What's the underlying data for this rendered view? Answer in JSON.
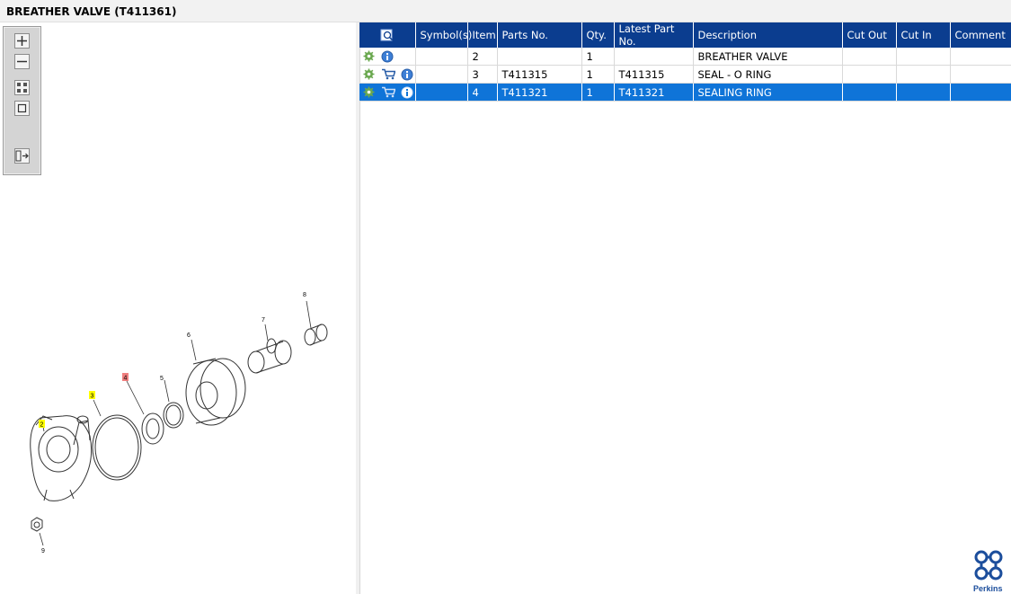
{
  "window": {
    "title": "BREATHER VALVE (T411361)"
  },
  "toolbar": {
    "buttons": [
      {
        "icon": "zoom-in-icon"
      },
      {
        "icon": "zoom-out-icon"
      },
      {
        "icon": "fit-page-icon"
      },
      {
        "icon": "actual-size-icon"
      },
      {
        "icon": "toggle-panel-icon"
      }
    ]
  },
  "diagram": {
    "callouts": [
      {
        "label": "2",
        "highlight": "#ffff00"
      },
      {
        "label": "3",
        "highlight": "#ffff00"
      },
      {
        "label": "4",
        "highlight": "#f08080"
      },
      {
        "label": "5",
        "highlight": "none"
      },
      {
        "label": "6",
        "highlight": "none"
      },
      {
        "label": "7",
        "highlight": "none"
      },
      {
        "label": "8",
        "highlight": "none"
      },
      {
        "label": "9",
        "highlight": "none"
      }
    ]
  },
  "parts_table": {
    "header_icon": "search-list-icon",
    "columns": [
      "Symbol(s)",
      "Item",
      "Parts No.",
      "Qty.",
      "Latest Part No.",
      "Description",
      "Cut Out",
      "Cut In",
      "Comment"
    ],
    "rows": [
      {
        "icons": [
          "gear-icon",
          "info-icon"
        ],
        "symbols": "",
        "item": "2",
        "part_no": "",
        "qty": "1",
        "latest_part_no": "",
        "description": "BREATHER VALVE",
        "cut_out": "",
        "cut_in": "",
        "comment": "",
        "selected": false
      },
      {
        "icons": [
          "gear-icon",
          "cart-icon",
          "info-icon"
        ],
        "symbols": "",
        "item": "3",
        "part_no": "T411315",
        "qty": "1",
        "latest_part_no": "T411315",
        "description": "SEAL - O RING",
        "cut_out": "",
        "cut_in": "",
        "comment": "",
        "selected": false
      },
      {
        "icons": [
          "gear-icon",
          "cart-icon",
          "info-icon"
        ],
        "symbols": "",
        "item": "4",
        "part_no": "T411321",
        "qty": "1",
        "latest_part_no": "T411321",
        "description": "SEALING RING",
        "cut_out": "",
        "cut_in": "",
        "comment": "",
        "selected": true
      }
    ]
  },
  "brand": {
    "name": "Perkins",
    "color": "#1c4e9c"
  },
  "colors": {
    "header_bg": "#0b3d8f",
    "selection_bg": "#0f74d8"
  }
}
